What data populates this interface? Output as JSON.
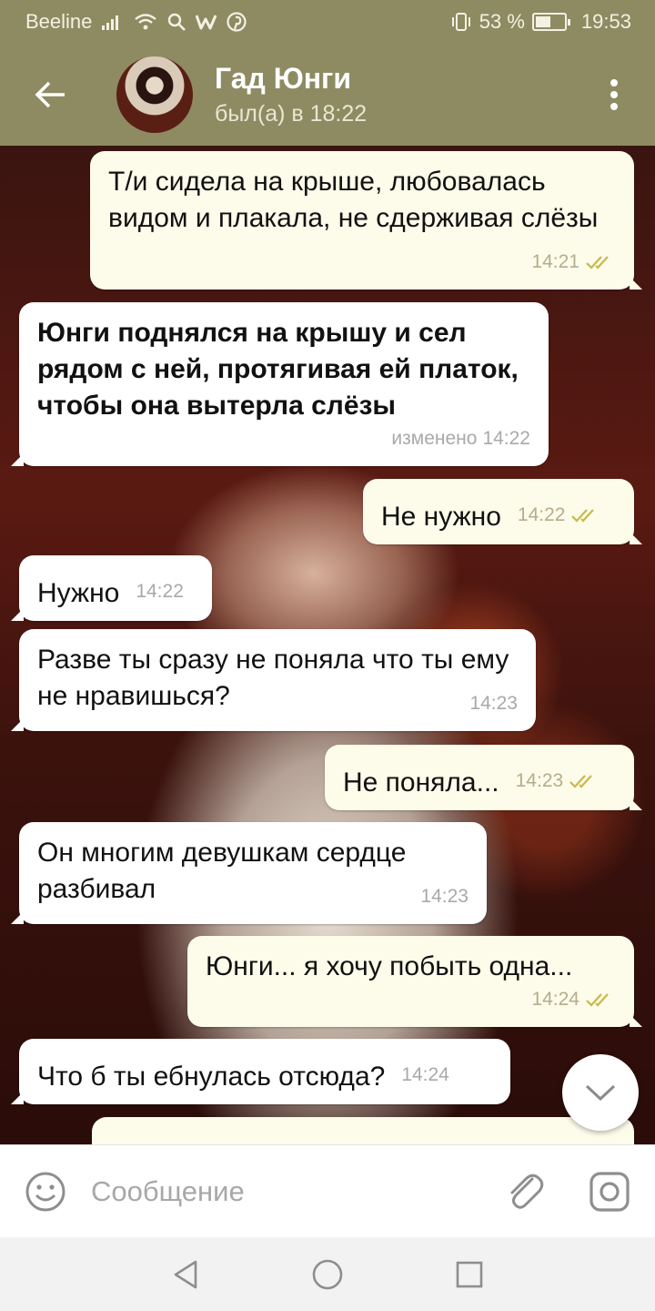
{
  "status_bar": {
    "carrier": "Beeline",
    "battery_percent": "53 %",
    "battery_level": 0.53,
    "time": "19:53",
    "icons": [
      "signal-icon",
      "wifi-icon",
      "search-icon",
      "w-app-icon",
      "pinterest-icon",
      "vibrate-icon",
      "battery-icon"
    ]
  },
  "header": {
    "name": "Гад Юнги",
    "status": "был(а) в 18:22",
    "icons": [
      "back-arrow-icon",
      "avatar",
      "more-vertical-icon"
    ]
  },
  "theme": {
    "bar_color": "#8e8b62",
    "incoming_bubble": "#ffffff",
    "outgoing_bubble": "#fdfbea",
    "check_color": "#c9b94a"
  },
  "messages": [
    {
      "direction": "out",
      "text": "Т/и сидела на крыше, любовалась видом и плакала, не сдерживая слёзы",
      "time": "14:21",
      "read": true
    },
    {
      "direction": "in",
      "text": "Юнги поднялся на крышу и сел рядом с ней, протягивая ей платок, чтобы она вытерла слёзы",
      "edited_label": "изменено",
      "time": "14:22"
    },
    {
      "direction": "out",
      "text": "Не нужно",
      "time": "14:22",
      "read": true
    },
    {
      "direction": "in",
      "text": "Нужно",
      "time": "14:22"
    },
    {
      "direction": "in",
      "text": "Разве ты сразу не поняла что ты ему не нравишься?",
      "time": "14:23"
    },
    {
      "direction": "out",
      "text": "Не поняла...",
      "time": "14:23",
      "read": true
    },
    {
      "direction": "in",
      "text": "Он многим девушкам сердце разбивал",
      "time": "14:23"
    },
    {
      "direction": "out",
      "text": "Юнги... я хочу побыть одна...",
      "time": "14:24",
      "read": true
    },
    {
      "direction": "in",
      "text": "Что б ты ебнулась отсюда?",
      "time": "14:24"
    }
  ],
  "input": {
    "placeholder": "Сообщение",
    "icons": [
      "emoji-icon",
      "attach-icon",
      "camera-icon"
    ]
  },
  "nav_bar": {
    "icons": [
      "nav-back-icon",
      "nav-home-icon",
      "nav-recents-icon"
    ]
  }
}
